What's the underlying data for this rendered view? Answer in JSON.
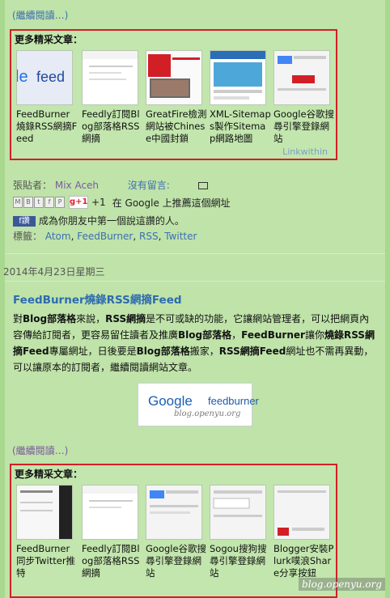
{
  "section1": {
    "read_more": "(繼續閱讀…)",
    "related": {
      "title": "更多精采文章：",
      "items": [
        {
          "caption": "FeedBurner燒錄RSS網摘Feed"
        },
        {
          "caption": "Feedly訂閱Blog部落格RSS網摘"
        },
        {
          "caption": "GreatFire檢測網站被Chinese中國封鎖"
        },
        {
          "caption": "XML-Sitemaps製作Sitemap網路地圖"
        },
        {
          "caption": "Google谷歌搜尋引擎登錄網站"
        }
      ],
      "linkwithin": "Linkwithin"
    },
    "meta": {
      "posted_by_label": "張貼者：",
      "author": "Mix Aceh",
      "no_comments": "沒有留言:",
      "gplus_label": "g+1",
      "gplus_count": "+1",
      "gplus_text": "在 Google 上推薦這個網址",
      "fb_text": "成為你朋友中第一個說這讚的人。",
      "labels_label": "標籤：",
      "labels": [
        "Atom",
        "FeedBurner",
        "RSS",
        "Twitter"
      ]
    }
  },
  "date_header": "2014年4月23日星期三",
  "post": {
    "title": "FeedBurner燒錄RSS網摘Feed",
    "image_logo": "Google",
    "image_feed": "feedburner",
    "image_watermark": "blog.openyu.org",
    "read_more": "(繼續閱讀…)"
  },
  "section2": {
    "related": {
      "title": "更多精采文章：",
      "items": [
        {
          "caption": "FeedBurner同步Twitter推特"
        },
        {
          "caption": "Feedly訂閱Blog部落格RSS網摘"
        },
        {
          "caption": "Google谷歌搜尋引擎登錄網站"
        },
        {
          "caption": "Sogou搜狗搜尋引擎登錄網站"
        },
        {
          "caption": "Blogger安裝Plurk噗浪Share分享按鈕"
        }
      ]
    }
  },
  "watermark": "blog.openyu.org"
}
